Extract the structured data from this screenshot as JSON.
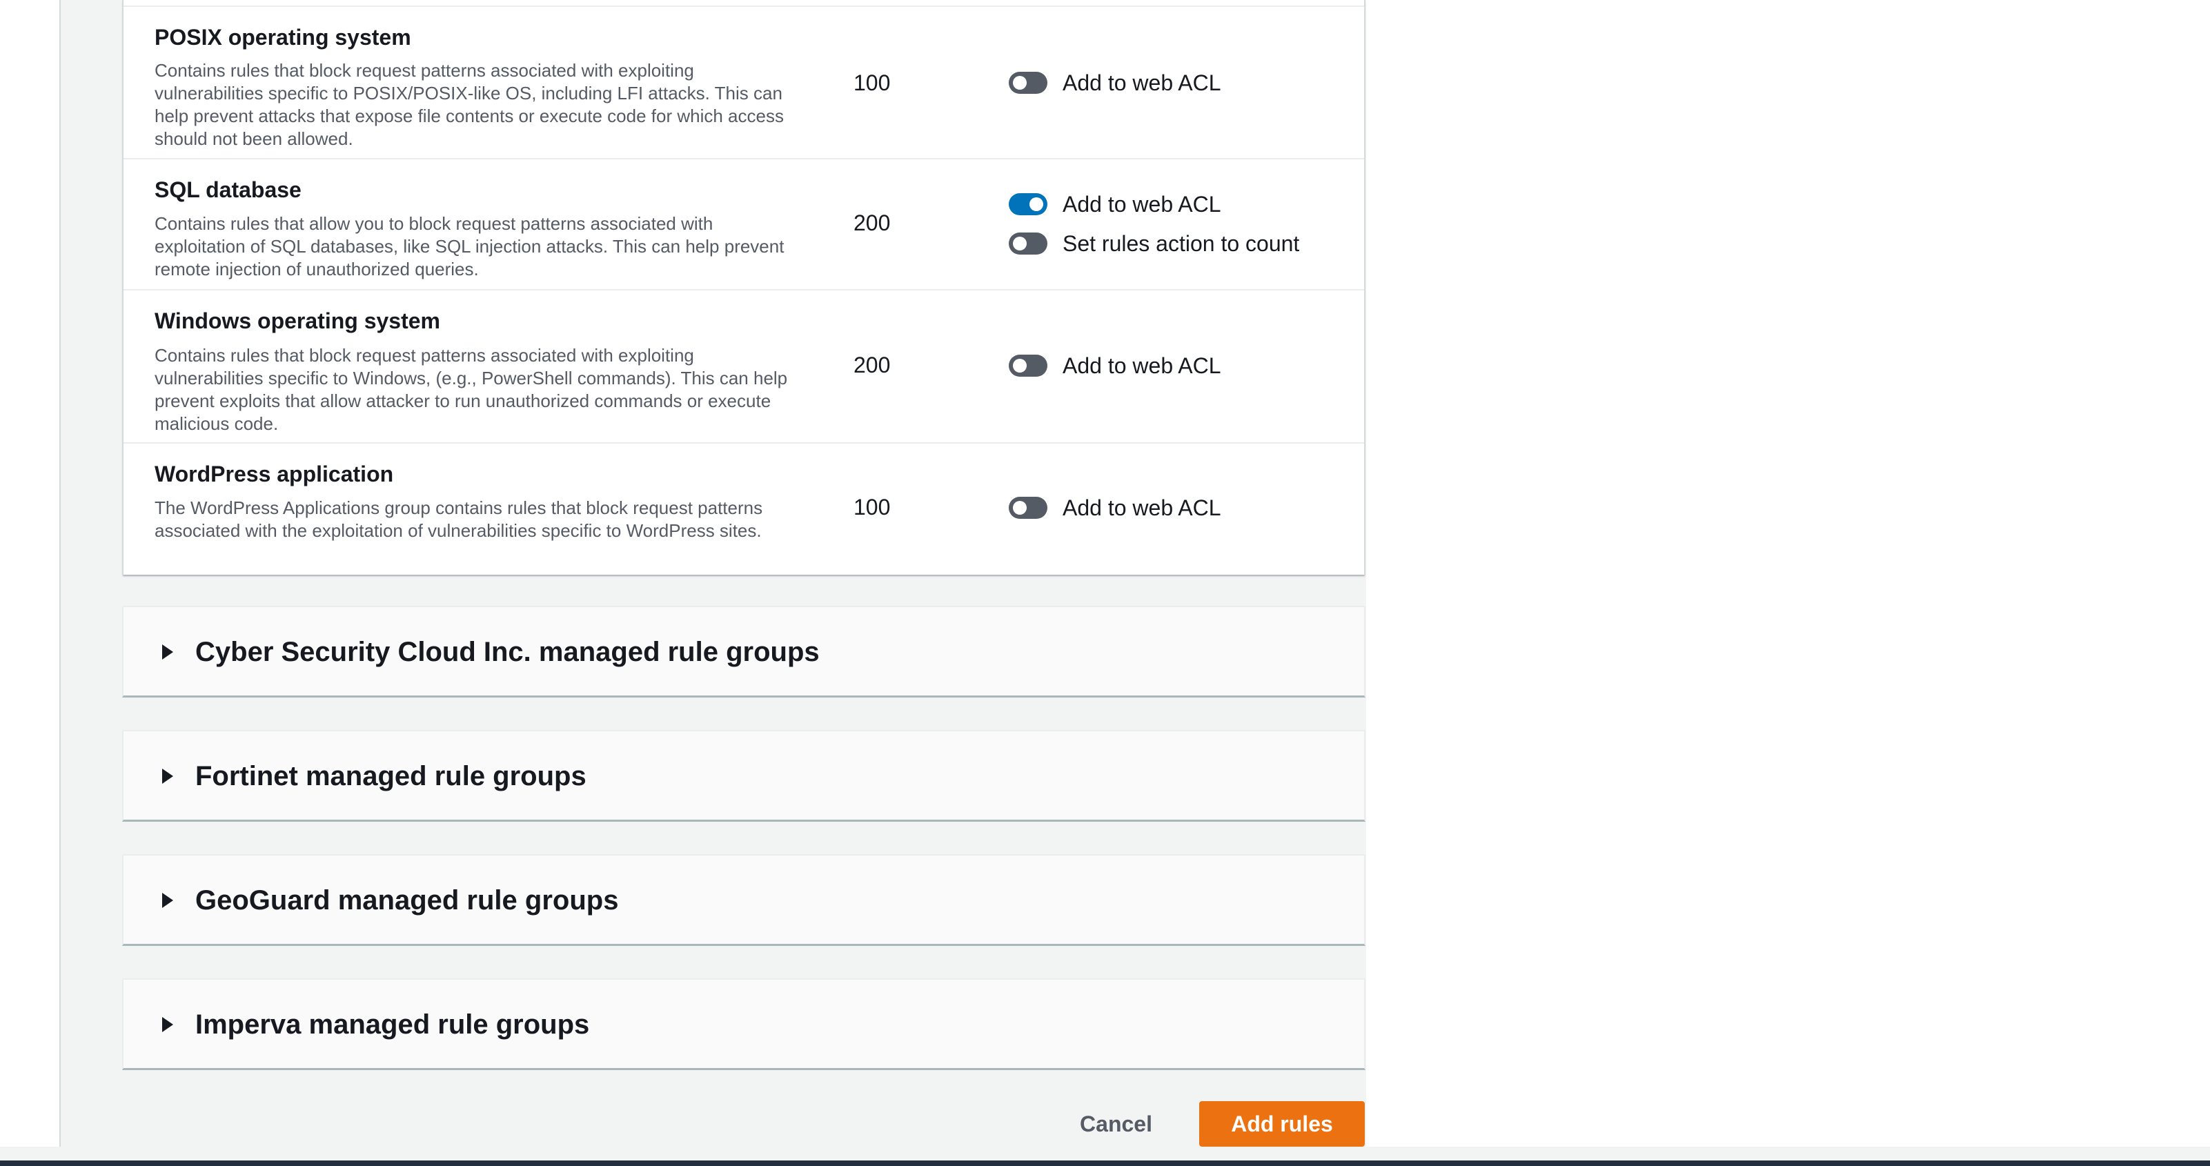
{
  "rules": [
    {
      "name": "POSIX operating system",
      "description": "Contains rules that block request patterns associated with exploiting vulnerabilities specific to POSIX/POSIX-like OS, including LFI attacks. This can help prevent attacks that expose file contents or execute code for which access should not been allowed.",
      "capacity": "100",
      "toggles": [
        {
          "label": "Add to web ACL",
          "on": false
        }
      ]
    },
    {
      "name": "SQL database",
      "description": "Contains rules that allow you to block request patterns associated with exploitation of SQL databases, like SQL injection attacks. This can help prevent remote injection of unauthorized queries.",
      "capacity": "200",
      "toggles": [
        {
          "label": "Add to web ACL",
          "on": true
        },
        {
          "label": "Set rules action to count",
          "on": false
        }
      ]
    },
    {
      "name": "Windows operating system",
      "description": "Contains rules that block request patterns associated with exploiting vulnerabilities specific to Windows, (e.g., PowerShell commands). This can help prevent exploits that allow attacker to run unauthorized commands or execute malicious code.",
      "capacity": "200",
      "toggles": [
        {
          "label": "Add to web ACL",
          "on": false
        }
      ]
    },
    {
      "name": "WordPress application",
      "description": "The WordPress Applications group contains rules that block request patterns associated with the exploitation of vulnerabilities specific to WordPress sites.",
      "capacity": "100",
      "toggles": [
        {
          "label": "Add to web ACL",
          "on": false
        }
      ]
    }
  ],
  "vendor_sections": [
    {
      "title": "Cyber Security Cloud Inc. managed rule groups",
      "expanded": false,
      "icon": "caret-right-icon"
    },
    {
      "title": "Fortinet managed rule groups",
      "expanded": false,
      "icon": "caret-right-icon"
    },
    {
      "title": "GeoGuard managed rule groups",
      "expanded": false,
      "icon": "caret-right-icon"
    },
    {
      "title": "Imperva managed rule groups",
      "expanded": false,
      "icon": "caret-right-icon"
    }
  ],
  "actions": {
    "cancel_label": "Cancel",
    "add_rules_label": "Add rules"
  },
  "colors": {
    "primary_button": "#ec7211",
    "toggle_on": "#0073bb",
    "toggle_off": "#545b64"
  }
}
